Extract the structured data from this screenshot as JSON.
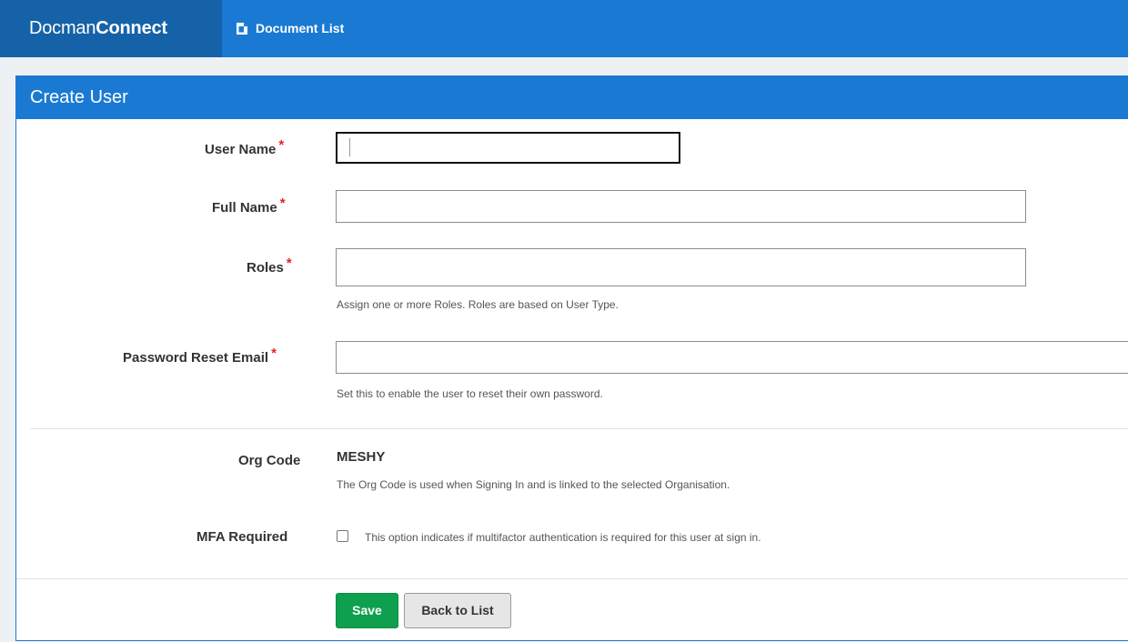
{
  "app": {
    "brand_regular": "Docman",
    "brand_bold": "Connect",
    "nav_document_list": "Document List"
  },
  "panel": {
    "title": "Create User"
  },
  "form": {
    "username": {
      "label": "User Name",
      "required_mark": "*",
      "value": ""
    },
    "fullname": {
      "label": "Full Name",
      "required_mark": "*",
      "value": ""
    },
    "roles": {
      "label": "Roles",
      "required_mark": "*",
      "value": "",
      "help": "Assign one or more Roles. Roles are based on User Type."
    },
    "reset_email": {
      "label": "Password Reset Email",
      "required_mark": "*",
      "value": "",
      "help": "Set this to enable the user to reset their own password."
    },
    "org_code": {
      "label": "Org Code",
      "value": "MESHY",
      "help": "The Org Code is used when Signing In and is linked to the selected Organisation."
    },
    "mfa": {
      "label": "MFA Required",
      "checked": false,
      "help": "This option indicates if multifactor authentication is required for this user at sign in."
    }
  },
  "actions": {
    "save_label": "Save",
    "back_label": "Back to List"
  },
  "colors": {
    "nav_blue": "#1a7ad3",
    "brand_blue": "#1562a8",
    "save_green": "#0ea04f",
    "required_red": "#e02424"
  },
  "icons": {
    "document_list": "document-icon"
  }
}
